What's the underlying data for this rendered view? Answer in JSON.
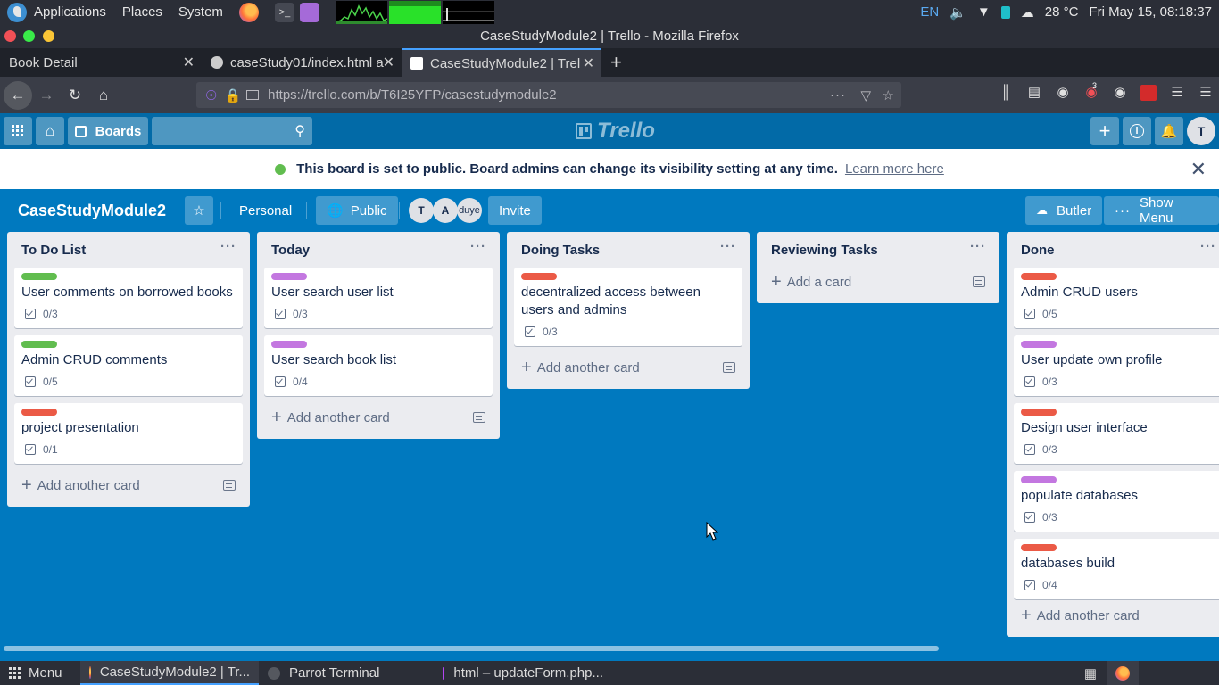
{
  "os_panel": {
    "menu_items": [
      "Applications",
      "Places",
      "System"
    ],
    "lang": "EN",
    "weather": "28 °C",
    "datetime": "Fri May 15, 08:18:37"
  },
  "browser": {
    "window_title": "CaseStudyModule2 | Trello - Mozilla Firefox",
    "tabs": [
      {
        "label": "Book Detail",
        "active": false
      },
      {
        "label": "caseStudy01/index.html a",
        "active": false
      },
      {
        "label": "CaseStudyModule2 | Trel",
        "active": true
      }
    ],
    "url": "https://trello.com/b/T6I25YFP/casestudymodule2",
    "notification_badge": "3"
  },
  "trello_header": {
    "boards_label": "Boards",
    "logo_text": "Trello",
    "user_initial": "T",
    "search_placeholder": ""
  },
  "banner": {
    "message": "This board is set to public. Board admins can change its visibility setting at any time.",
    "link": "Learn more here"
  },
  "board": {
    "title": "CaseStudyModule2",
    "team_label": "Personal",
    "visibility_label": "Public",
    "members": [
      "T",
      "A",
      "duye"
    ],
    "invite_label": "Invite",
    "butler_label": "Butler",
    "show_menu_label": "Show Menu"
  },
  "colors": {
    "green": "#61bd4f",
    "purple": "#c377e0",
    "red": "#eb5a46",
    "board_bg": "#0079bf"
  },
  "lists": [
    {
      "name": "To Do List",
      "add_label": "Add another card",
      "cards": [
        {
          "label_color": "green",
          "title": "User comments on borrowed books",
          "checklist": "0/3"
        },
        {
          "label_color": "green",
          "title": "Admin CRUD comments",
          "checklist": "0/5"
        },
        {
          "label_color": "red",
          "title": "project presentation",
          "checklist": "0/1"
        }
      ]
    },
    {
      "name": "Today",
      "add_label": "Add another card",
      "cards": [
        {
          "label_color": "purple",
          "title": "User search user list",
          "checklist": "0/3"
        },
        {
          "label_color": "purple",
          "title": "User search book list",
          "checklist": "0/4"
        }
      ]
    },
    {
      "name": "Doing Tasks",
      "add_label": "Add another card",
      "cards": [
        {
          "label_color": "red",
          "title": "decentralized access between users and admins",
          "checklist": "0/3"
        }
      ]
    },
    {
      "name": "Reviewing Tasks",
      "add_label": "Add a card",
      "cards": []
    },
    {
      "name": "Done",
      "add_label": "Add another card",
      "cards": [
        {
          "label_color": "red",
          "title": "Admin CRUD users",
          "checklist": "0/5"
        },
        {
          "label_color": "purple",
          "title": "User update own profile",
          "checklist": "0/3"
        },
        {
          "label_color": "red",
          "title": "Design user interface",
          "checklist": "0/3"
        },
        {
          "label_color": "purple",
          "title": "populate databases",
          "checklist": "0/3"
        },
        {
          "label_color": "red",
          "title": "databases build",
          "checklist": "0/4"
        }
      ]
    }
  ],
  "taskbar": {
    "menu_label": "Menu",
    "tasks": [
      {
        "label": "CaseStudyModule2 | Tr...",
        "active": true
      },
      {
        "label": "Parrot Terminal",
        "active": false
      },
      {
        "label": "html – updateForm.php...",
        "active": false
      }
    ]
  }
}
